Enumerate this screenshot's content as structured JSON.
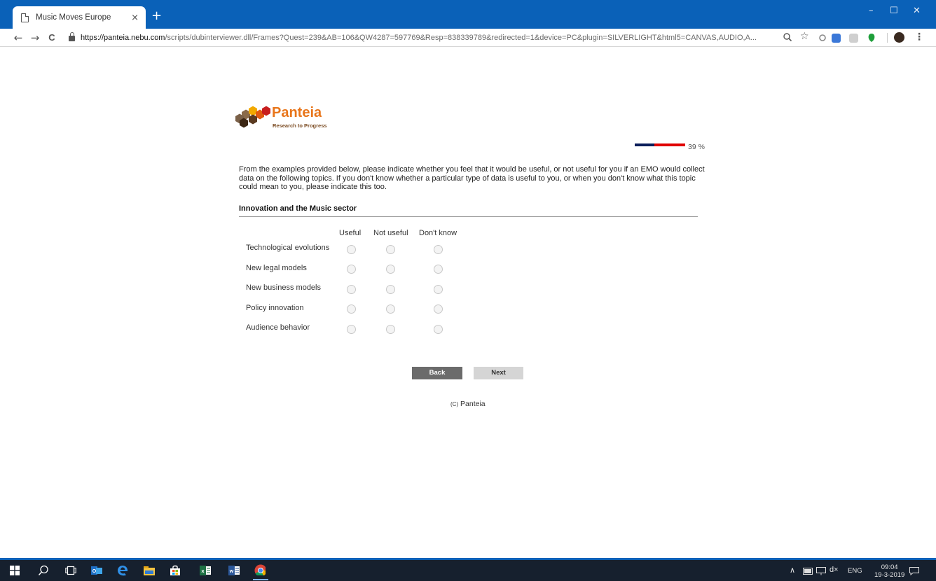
{
  "browser": {
    "tab_title": "Music Moves Europe",
    "tab_close": "×",
    "new_tab": "+",
    "window_controls": {
      "minimize": "–",
      "maximize": "☐",
      "close": "✕"
    },
    "url_host": "https://panteia.nebu.com",
    "url_path": "/scripts/dubinterviewer.dll/Frames?Quest=239&AB=106&QW4287=597769&Resp=838339789&redirected=1&device=PC&plugin=SILVERLIGHT&html5=CANVAS,AUDIO,A...",
    "nav": {
      "back": "←",
      "forward": "→",
      "reload": "C"
    },
    "toolbar_icons": [
      "zoom-icon",
      "star-icon",
      "extension-icon",
      "translate-icon",
      "pdf-icon",
      "evernote-icon",
      "avatar",
      "menu-icon"
    ]
  },
  "logo": {
    "name": "Panteia",
    "tagline": "Research to Progress",
    "colors": [
      "#f2a900",
      "#e05a10",
      "#c81e1e",
      "#8a6a4a",
      "#5a3a20"
    ]
  },
  "progress": {
    "value": 0.39,
    "label": "39 %",
    "fill_color": "#0b1e5a",
    "rest_color": "#e00000"
  },
  "survey": {
    "intro": "From the examples provided below, please indicate whether you feel that it would be useful, or not useful for you if an EMO would collect data on the following topics. If you don't know whether a particular type of data is useful to you, or when you don't know what this topic could mean to you, please indicate this too.",
    "section": "Innovation and the Music sector",
    "columns": [
      "Useful",
      "Not useful",
      "Don't know"
    ],
    "rows": [
      "Technological evolutions",
      "New legal models",
      "New business models",
      "Policy innovation",
      "Audience behavior"
    ]
  },
  "buttons": {
    "back": "Back",
    "next": "Next"
  },
  "footer": {
    "prefix": "(C)",
    "text": "Panteia"
  },
  "taskbar": {
    "apps": [
      "windows-start-icon",
      "search-icon",
      "task-view-icon",
      "outlook-icon",
      "edge-icon",
      "file-explorer-icon",
      "store-icon",
      "excel-icon",
      "word-icon",
      "chrome-icon"
    ],
    "tray": {
      "lang": "ENG",
      "time": "09:04",
      "date": "19-3-2019"
    }
  }
}
